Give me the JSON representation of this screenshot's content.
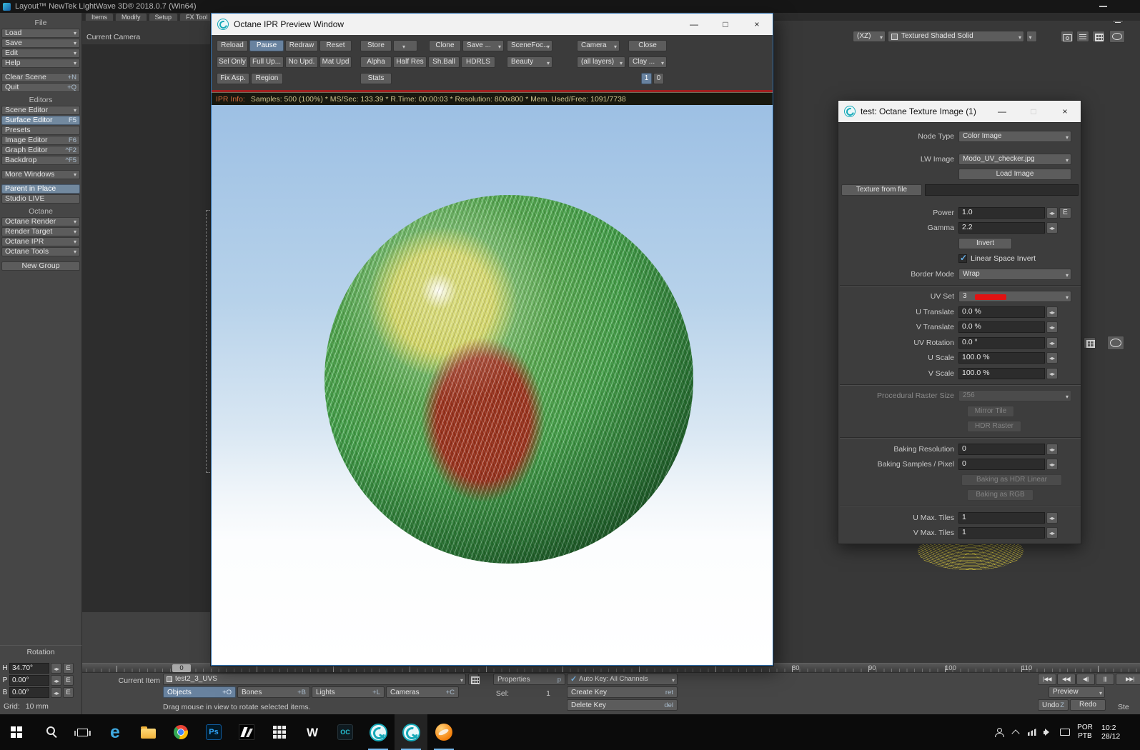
{
  "colors": {
    "selection_blue": "#72899f",
    "uv_set_swatch_red": "#e11212",
    "octane_teal": "#17a9b8",
    "ipr_info_label_orange": "#cf6a3c",
    "ipr_alert_line_red": "#a02020"
  },
  "os": {
    "app_title": "Layout™ NewTek LightWave 3D® 2018.0.7 (Win64)"
  },
  "winctl": {
    "min": "—",
    "max": "□",
    "close": "×"
  },
  "tabs": {
    "t0": "Items",
    "t1": "Modify",
    "t2": "Setup",
    "t3": "FX Tool"
  },
  "sidebar": {
    "file_header": "File",
    "load": "Load",
    "save": "Save",
    "edit": "Edit",
    "help": "Help",
    "clear_scene": "Clear Scene",
    "clear_scene_key": "+N",
    "quit": "Quit",
    "quit_key": "+Q",
    "editors_header": "Editors",
    "scene_editor": "Scene Editor",
    "surface_editor": "Surface Editor",
    "surface_editor_key": "F5",
    "presets": "Presets",
    "image_editor": "Image Editor",
    "image_editor_key": "F6",
    "graph_editor": "Graph Editor",
    "graph_editor_key": "^F2",
    "backdrop": "Backdrop",
    "backdrop_key": "^F5",
    "more_windows": "More Windows",
    "parent_in_place": "Parent in Place",
    "studio_live": "Studio LIVE",
    "octane_header": "Octane",
    "octane_render": "Octane Render",
    "render_target": "Render Target",
    "octane_ipr": "Octane IPR",
    "octane_tools": "Octane Tools",
    "new_group": "New Group",
    "rotation_header": "Rotation",
    "h_label": "H",
    "h_value": "34.70°",
    "p_label": "P",
    "p_value": "0.00°",
    "b_label": "B",
    "b_value": "0.00°",
    "envelope": "E",
    "grid_label": "Grid:",
    "grid_value": "10 mm"
  },
  "viewport": {
    "current_camera": "Current Camera",
    "axis": "(XZ)",
    "shading": "Textured Shaded Solid"
  },
  "ipr": {
    "title": "Octane IPR Preview Window",
    "b_reload": "Reload",
    "b_pause": "Pause",
    "b_redraw": "Redraw",
    "b_reset": "Reset",
    "b_store": "Store",
    "b_clone": "Clone",
    "b_save": "Save ...",
    "b_scenefoc": "SceneFoc...",
    "b_camera": "Camera",
    "b_close": "Close",
    "b_selonly": "Sel Only",
    "b_fullup": "Full Up...",
    "b_noupd": "No Upd.",
    "b_matupd": "Mat Upd",
    "b_alpha": "Alpha",
    "b_halfres": "Half Res",
    "b_shball": "Sh.Ball",
    "b_hdrls": "HDRLS",
    "b_beauty": "Beauty",
    "b_alllayers": "(all layers)",
    "b_clay": "Clay ...",
    "b_fixasp": "Fix Asp.",
    "b_region": "Region",
    "b_stats": "Stats",
    "t_one": "1",
    "t_zero": "0",
    "info_label": "IPR Info:",
    "info_text": "Samples: 500 (100%)  *  MS/Sec: 133.39  *  R.Time: 00:00:03  *  Resolution: 800x800  *  Mem. Used/Free: 1091/7738"
  },
  "texture": {
    "title": "test: Octane Texture Image (1)",
    "node_type_label": "Node Type",
    "node_type": "Color Image",
    "lw_image_label": "LW Image",
    "lw_image": "Modo_UV_checker.jpg",
    "load_image": "Load Image",
    "texture_from_file": "Texture from file",
    "power_label": "Power",
    "power": "1.0",
    "envelope": "E",
    "gamma_label": "Gamma",
    "gamma": "2.2",
    "invert": "Invert",
    "linear_space_invert": "Linear Space Invert",
    "border_mode_label": "Border Mode",
    "border_mode": "Wrap",
    "uv_set_label": "UV Set",
    "uv_set": "3",
    "u_translate_label": "U Translate",
    "u_translate": "0.0 %",
    "v_translate_label": "V Translate",
    "v_translate": "0.0 %",
    "uv_rotation_label": "UV Rotation",
    "uv_rotation": "0.0 °",
    "u_scale_label": "U Scale",
    "u_scale": "100.0 %",
    "v_scale_label": "V Scale",
    "v_scale": "100.0 %",
    "proc_raster_label": "Procedural Raster Size",
    "proc_raster": "256",
    "mirror_tile": "Mirror Tile",
    "hdr_raster": "HDR Raster",
    "baking_resolution_label": "Baking Resolution",
    "baking_resolution": "0",
    "baking_samples_label": "Baking Samples / Pixel",
    "baking_samples": "0",
    "baking_hdr": "Baking as HDR Linear",
    "baking_rgb": "Baking as RGB",
    "u_max_label": "U Max. Tiles",
    "u_max": "1",
    "v_max_label": "V Max. Tiles",
    "v_max": "1"
  },
  "timeline": {
    "frame": "0",
    "m80": "80",
    "m90": "90",
    "m100": "100",
    "m110": "110"
  },
  "bottom": {
    "current_item_label": "Current Item",
    "current_item": "test2_3_UVS",
    "properties": "Properties",
    "properties_key": "p",
    "auto_key": "Auto Key: All Channels",
    "objects": "Objects",
    "objects_key": "+O",
    "bones": "Bones",
    "bones_key": "+B",
    "lights": "Lights",
    "lights_key": "+L",
    "cameras": "Cameras",
    "cameras_key": "+C",
    "sel_label": "Sel:",
    "sel_value": "1",
    "create_key": "Create Key",
    "create_key_key": "ret",
    "delete_key": "Delete Key",
    "delete_key_key": "del",
    "status": "Drag mouse in view to rotate selected items.",
    "preview": "Preview",
    "undo": "Undo",
    "undo_key": "Z",
    "redo": "Redo",
    "step_partial": "Ste",
    "tr1": "|◀◀",
    "tr2": "◀◀|",
    "tr3": "◀||",
    "tr4": "|||",
    "tr5": "▶▶|"
  },
  "taskbar": {
    "edge_letter": "e",
    "ps_label": "Ps",
    "word_letter": "W",
    "oc_label": "OC",
    "lang_top": "POR",
    "lang_bottom": "PTB",
    "time": "10:2",
    "date": "28/12"
  }
}
